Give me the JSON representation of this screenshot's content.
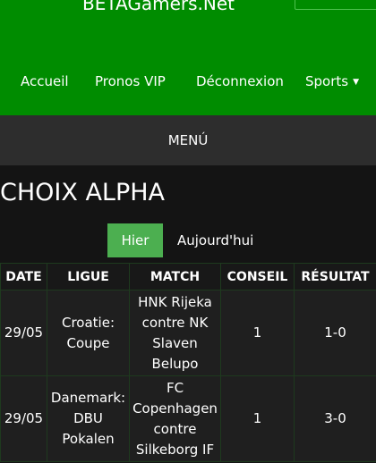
{
  "site": {
    "logo_text": "BETAGamers.Net"
  },
  "nav": {
    "items": [
      {
        "label": "Accueil"
      },
      {
        "label": "Pronos VIP"
      },
      {
        "label": "Déconnexion"
      },
      {
        "label": "Sports",
        "caret": "▼"
      }
    ]
  },
  "menu": {
    "label": "MENÚ"
  },
  "section": {
    "title": "CHOIX ALPHA"
  },
  "tabs": [
    {
      "label": "Hier",
      "active": true
    },
    {
      "label": "Aujourd'hui",
      "active": false
    }
  ],
  "table": {
    "headers": [
      "DATE",
      "LIGUE",
      "MATCH",
      "CONSEIL",
      "RÉSULTAT"
    ],
    "rows": [
      {
        "date": "29/05",
        "league": "Croatie: Coupe",
        "match": "HNK Rijeka contre NK Slaven Belupo",
        "advice": "1",
        "result": "1-0"
      },
      {
        "date": "29/05",
        "league": "Danemark: DBU Pokalen",
        "match": "FC Copenhagen contre Silkeborg IF",
        "advice": "1",
        "result": "3-0"
      }
    ]
  },
  "colors": {
    "header_green": "#008c00",
    "active_tab": "#4caf50",
    "menu_bar": "#2d2d2d",
    "background": "#141414"
  }
}
